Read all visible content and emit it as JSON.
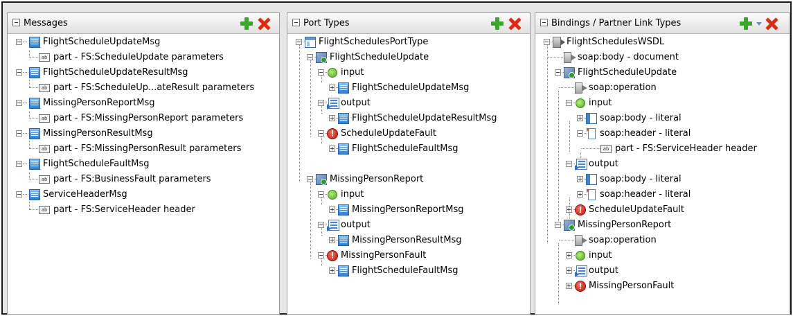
{
  "panels": {
    "messages": {
      "title": "Messages",
      "rows": [
        {
          "label": "FlightScheduleUpdateMsg"
        },
        {
          "label": "part - FS:ScheduleUpdate parameters"
        },
        {
          "label": "FlightScheduleUpdateResultMsg"
        },
        {
          "label": "part - FS:ScheduleUp...ateResult parameters"
        },
        {
          "label": "MissingPersonReportMsg"
        },
        {
          "label": "part - FS:MissingPersonReport parameters"
        },
        {
          "label": "MissingPersonResultMsg"
        },
        {
          "label": "part - FS:MissingPersonResult parameters"
        },
        {
          "label": "FlightScheduleFaultMsg"
        },
        {
          "label": "part - FS:BusinessFault parameters"
        },
        {
          "label": "ServiceHeaderMsg"
        },
        {
          "label": "part - FS:ServiceHeader header"
        }
      ]
    },
    "port_types": {
      "title": "Port Types",
      "rows": [
        {
          "label": "FlightSchedulesPortType"
        },
        {
          "label": "FlightScheduleUpdate"
        },
        {
          "label": "input"
        },
        {
          "label": "FlightScheduleUpdateMsg"
        },
        {
          "label": "output"
        },
        {
          "label": "FlightScheduleUpdateResultMsg"
        },
        {
          "label": "ScheduleUpdateFault"
        },
        {
          "label": "FlightScheduleFaultMsg"
        },
        {
          "label": "MissingPersonReport"
        },
        {
          "label": "input"
        },
        {
          "label": "MissingPersonReportMsg"
        },
        {
          "label": "output"
        },
        {
          "label": "MissingPersonResultMsg"
        },
        {
          "label": "MissingPersonFault"
        },
        {
          "label": "FlightScheduleFaultMsg"
        }
      ]
    },
    "bindings": {
      "title": "Bindings / Partner Link Types",
      "rows": [
        {
          "label": "FlightSchedulesWSDL"
        },
        {
          "label": "soap:body - document"
        },
        {
          "label": "FlightScheduleUpdate"
        },
        {
          "label": "soap:operation"
        },
        {
          "label": "input"
        },
        {
          "label": "soap:body - literal"
        },
        {
          "label": "soap:header - literal"
        },
        {
          "label": "part - FS:ServiceHeader header"
        },
        {
          "label": "output"
        },
        {
          "label": "soap:body - literal"
        },
        {
          "label": "soap:header - literal"
        },
        {
          "label": "ScheduleUpdateFault"
        },
        {
          "label": "MissingPersonReport"
        },
        {
          "label": "soap:operation"
        },
        {
          "label": "input"
        },
        {
          "label": "output"
        },
        {
          "label": "MissingPersonFault"
        }
      ]
    }
  },
  "icons": {
    "add": "green-plus-icon",
    "delete": "red-x-icon",
    "collapse": "collapse-box-icon",
    "dropdown": "chevron-down-icon"
  },
  "colors": {
    "add": "#3ba52c",
    "delete": "#de2b10",
    "panel_header": "#e1e1e1",
    "background": "#e6e6e6"
  }
}
